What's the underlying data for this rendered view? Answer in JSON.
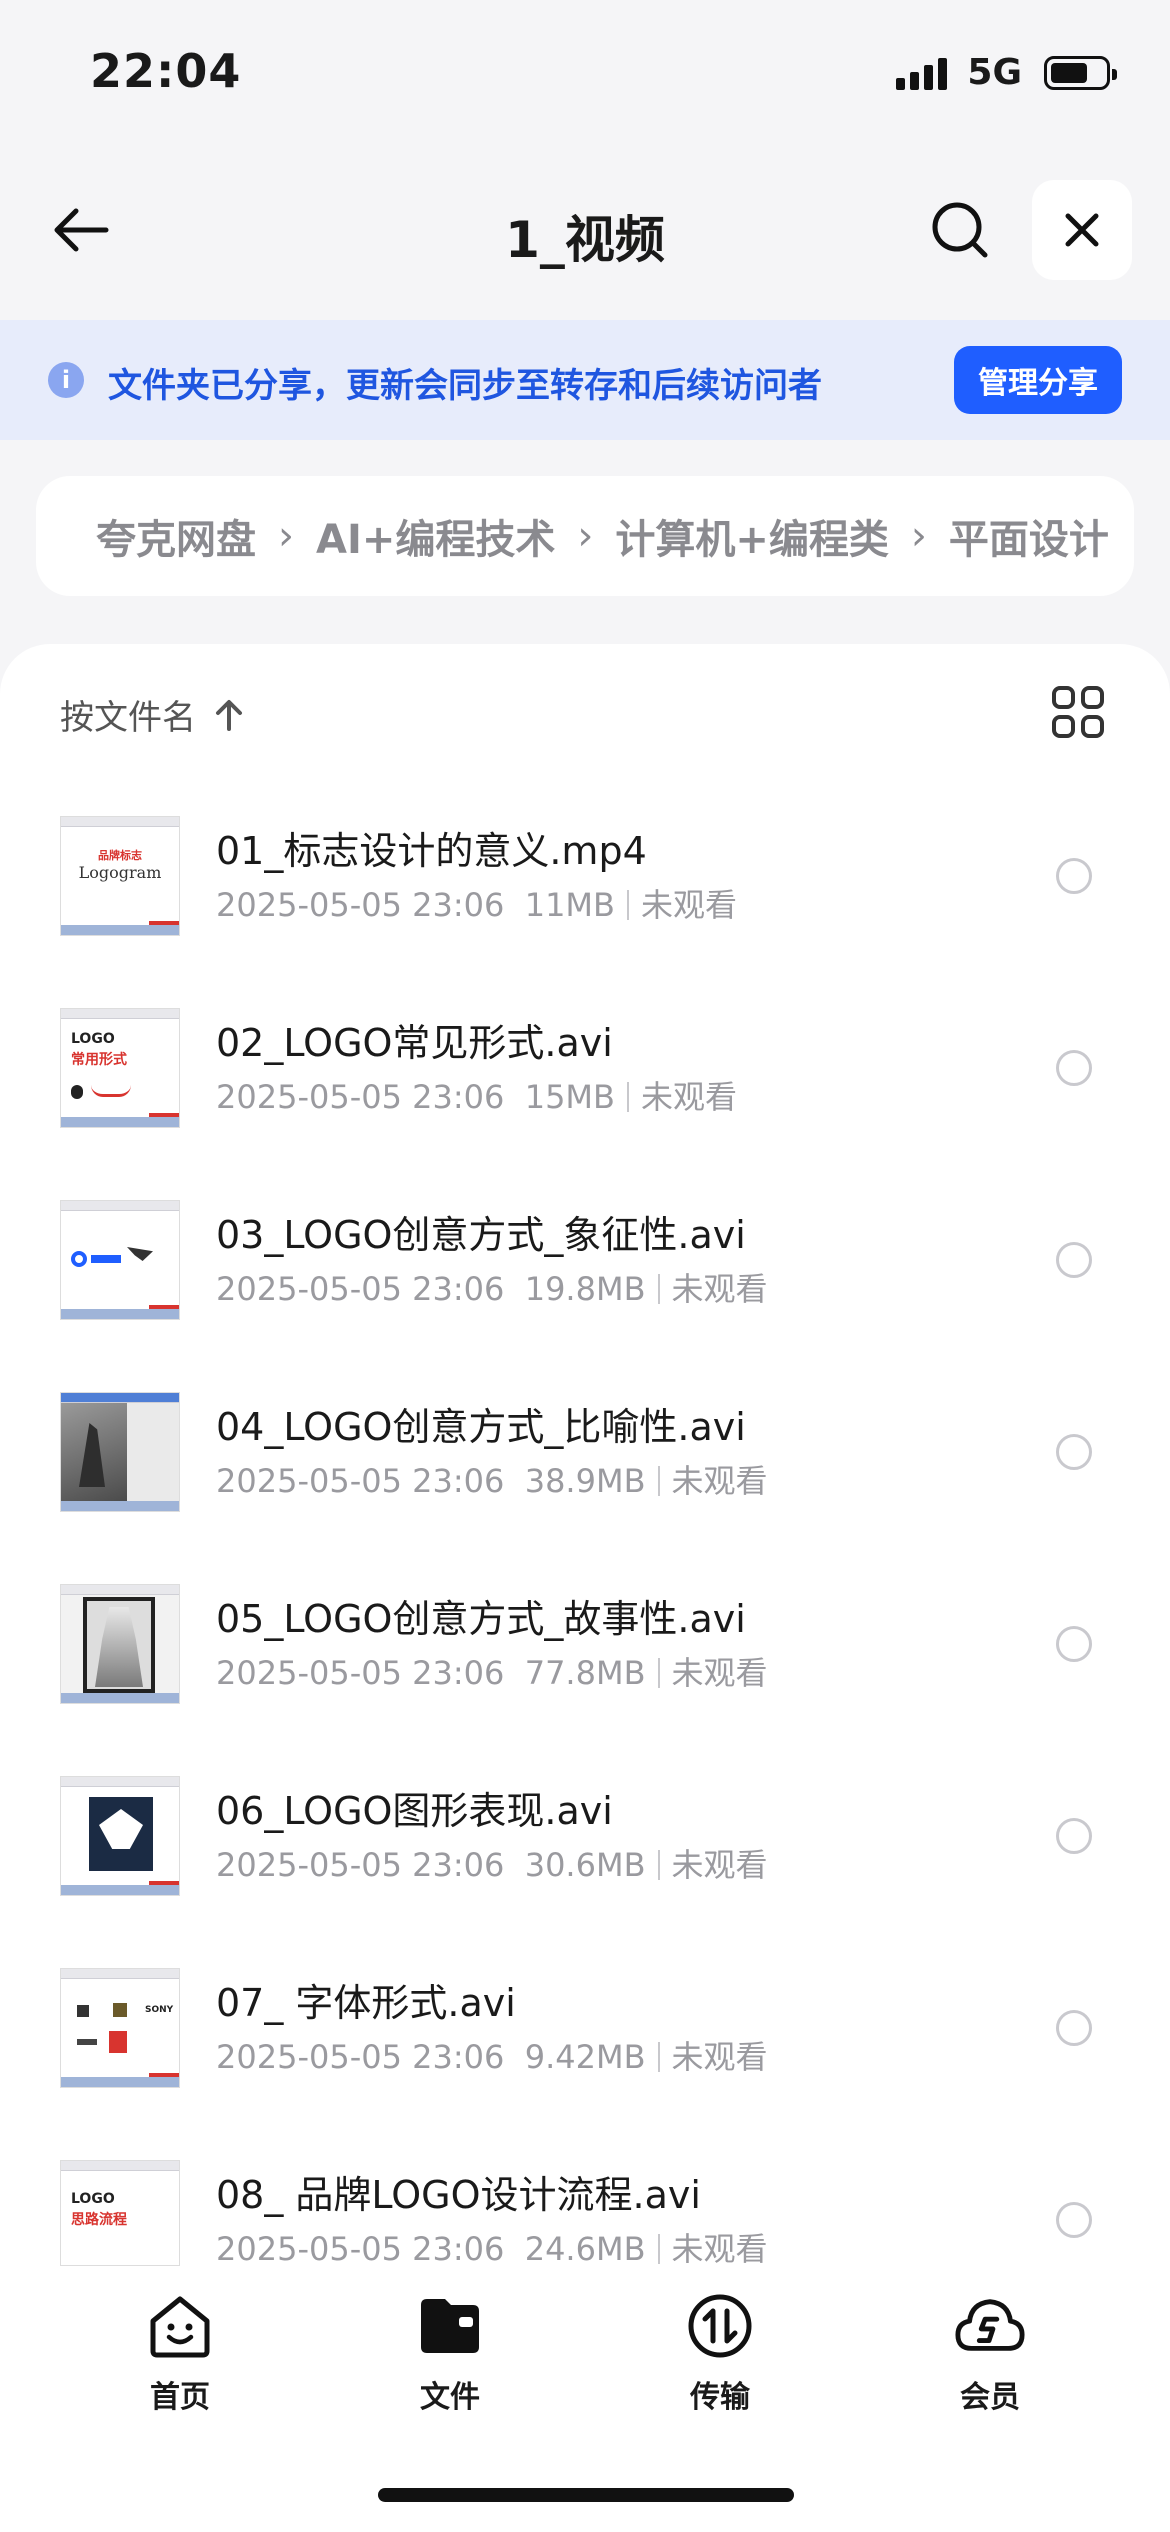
{
  "status": {
    "time": "22:04",
    "network": "5G"
  },
  "nav": {
    "title": "1_视频",
    "icons": {
      "back": "arrow-left-icon",
      "search": "search-icon",
      "close": "close-icon"
    }
  },
  "banner": {
    "text": "文件夹已分享，更新会同步至转存和后续访问者",
    "button": "管理分享",
    "icon": "info-icon",
    "accent": "#1f5eff"
  },
  "breadcrumb": {
    "items": [
      "夸克网盘",
      "AI+编程技术",
      "计算机+编程类",
      "平面设计"
    ],
    "separator": "›"
  },
  "sort": {
    "label": "按文件名",
    "direction": "ascending",
    "view_icon": "grid-view-icon"
  },
  "files": [
    {
      "name": "01_标志设计的意义.mp4",
      "date": "2025-05-05 23:06",
      "size": "11MB",
      "status": "未观看",
      "thumb_title": "品牌标志",
      "thumb_sub": "Logogram"
    },
    {
      "name": "02_LOGO常见形式.avi",
      "date": "2025-05-05 23:06",
      "size": "15MB",
      "status": "未观看",
      "thumb_title": "LOGO",
      "thumb_sub": "常用形式"
    },
    {
      "name": "03_LOGO创意方式_象征性.avi",
      "date": "2025-05-05 23:06",
      "size": "19.8MB",
      "status": "未观看",
      "thumb_title": "",
      "thumb_sub": ""
    },
    {
      "name": "04_LOGO创意方式_比喻性.avi",
      "date": "2025-05-05 23:06",
      "size": "38.9MB",
      "status": "未观看",
      "thumb_title": "",
      "thumb_sub": ""
    },
    {
      "name": "05_LOGO创意方式_故事性.avi",
      "date": "2025-05-05 23:06",
      "size": "77.8MB",
      "status": "未观看",
      "thumb_title": "",
      "thumb_sub": ""
    },
    {
      "name": "06_LOGO图形表现.avi",
      "date": "2025-05-05 23:06",
      "size": "30.6MB",
      "status": "未观看",
      "thumb_title": "",
      "thumb_sub": ""
    },
    {
      "name": "07_ 字体形式.avi",
      "date": "2025-05-05 23:06",
      "size": "9.42MB",
      "status": "未观看",
      "thumb_title": "",
      "thumb_sub": "SONY"
    },
    {
      "name": "08_ 品牌LOGO设计流程.avi",
      "date": "2025-05-05 23:06",
      "size": "24.6MB",
      "status": "未观看",
      "thumb_title": "LOGO",
      "thumb_sub": "思路流程"
    }
  ],
  "tabs": [
    {
      "label": "首页",
      "icon": "home-smile-icon"
    },
    {
      "label": "文件",
      "icon": "folder-icon",
      "active": true
    },
    {
      "label": "传输",
      "icon": "transfer-icon"
    },
    {
      "label": "会员",
      "icon": "member-cloud-icon"
    }
  ]
}
